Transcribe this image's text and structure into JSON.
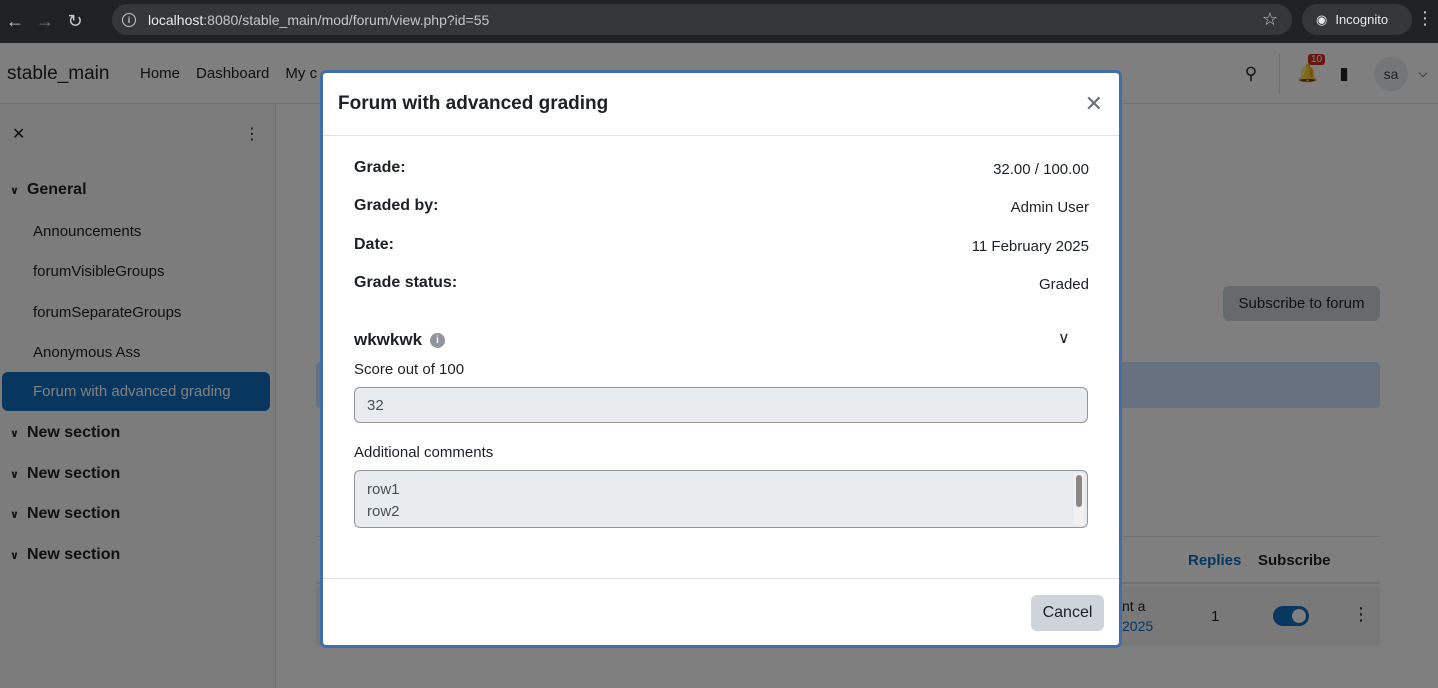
{
  "browser": {
    "url_host": "localhost",
    "url_path": ":8080/stable_main/mod/forum/view.php?id=55",
    "incognito_label": "Incognito"
  },
  "site": {
    "brand": "stable_main",
    "nav": [
      "Home",
      "Dashboard",
      "My c"
    ],
    "notification_count": "10",
    "avatar_initials": "sa"
  },
  "drawer": {
    "sections": [
      "General",
      "New section",
      "New section",
      "New section",
      "New section"
    ],
    "activities": [
      "Announcements",
      "forumVisibleGroups",
      "forumSeparateGroups",
      "Anonymous Ass"
    ],
    "active_activity": "Forum with advanced grading"
  },
  "page": {
    "subscribe_label": "Subscribe to forum",
    "col_replies": "Replies",
    "col_subscribe": "Subscribe",
    "row_frag1": "nt a",
    "row_frag2": "2025",
    "row_replies": "1"
  },
  "modal": {
    "title": "Forum with advanced grading",
    "info": [
      {
        "label": "Grade:",
        "value": "32.00 / 100.00"
      },
      {
        "label": "Graded by:",
        "value": "Admin User"
      },
      {
        "label": "Date:",
        "value": "11 February 2025"
      },
      {
        "label": "Grade status:",
        "value": "Graded"
      }
    ],
    "criterion": {
      "name": "wkwkwk",
      "score_label": "Score out of 100",
      "score_value": "32",
      "comments_label": "Additional comments",
      "comments_lines": [
        "row1",
        "row2"
      ]
    },
    "cancel_label": "Cancel"
  }
}
